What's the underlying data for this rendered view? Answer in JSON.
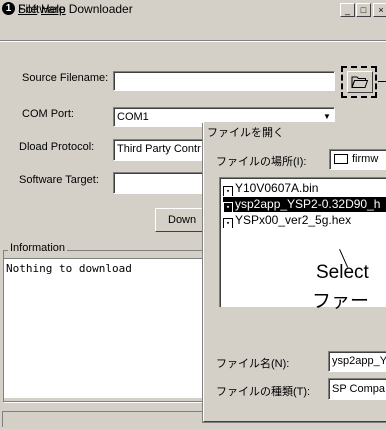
{
  "window": {
    "icon_glyph": "1",
    "title": "Software Downloader",
    "minimize_glyph": "_",
    "maximize_glyph": "□",
    "close_glyph": "×"
  },
  "menu": {
    "file": "File",
    "help": "Help"
  },
  "form": {
    "source_label": "Source Filename:",
    "source_value": "",
    "com_label": "COM Port:",
    "com_value": "COM1",
    "protocol_label": "Dload Protocol:",
    "protocol_value": "Third Party Contr",
    "target_label": "Software Target:",
    "target_value": "",
    "download_label": "Down"
  },
  "information": {
    "legend": "Information",
    "text": "Nothing to download"
  },
  "dialog": {
    "title": "ファイルを開く",
    "look_in_label": "ファイルの場所(I):",
    "look_in_value": "firmw",
    "files": [
      {
        "name": "Y10V0607A.bin",
        "selected": false
      },
      {
        "name": "ysp2app_YSP2-0.32D90_h",
        "selected": true
      },
      {
        "name": "YSPx00_ver2_5g.hex",
        "selected": false
      }
    ],
    "filename_label": "ファイル名(N):",
    "filename_value": "ysp2app_Y",
    "filetype_label": "ファイルの種類(T):",
    "filetype_value": "SP Compa"
  },
  "annotation": {
    "line1": "Select",
    "line2": "ファー"
  },
  "icons": {
    "browse": "folder-open-icon",
    "dropdown": "chevron-down-icon",
    "file": "file-icon"
  }
}
